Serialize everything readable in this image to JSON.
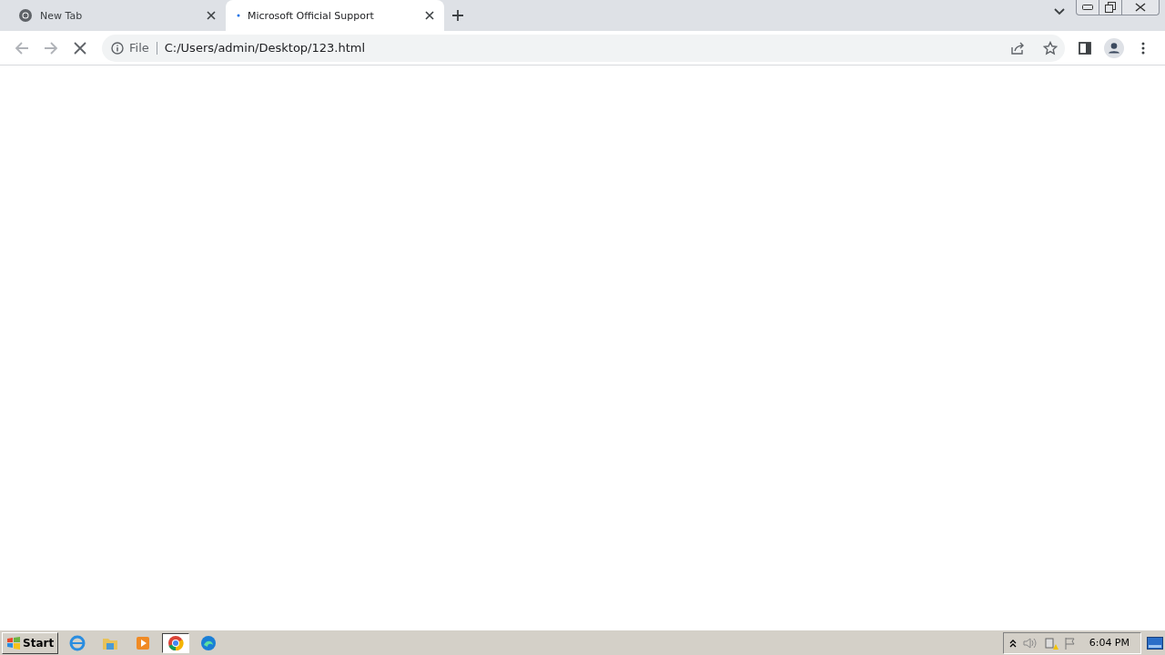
{
  "tabs": [
    {
      "title": "New Tab",
      "selected": false,
      "loading": false
    },
    {
      "title": "Microsoft Official Support",
      "selected": true,
      "loading": true
    }
  ],
  "address_bar": {
    "scheme": "File",
    "url": "C:/Users/admin/Desktop/123.html",
    "loading": true
  },
  "taskbar": {
    "start": "Start",
    "apps": [
      {
        "kind": "globe",
        "selected": false
      },
      {
        "kind": "folder",
        "selected": false
      },
      {
        "kind": "player",
        "selected": false
      },
      {
        "kind": "browser",
        "selected": true
      },
      {
        "kind": "wave",
        "selected": false
      }
    ],
    "clock": "6:04 PM"
  }
}
